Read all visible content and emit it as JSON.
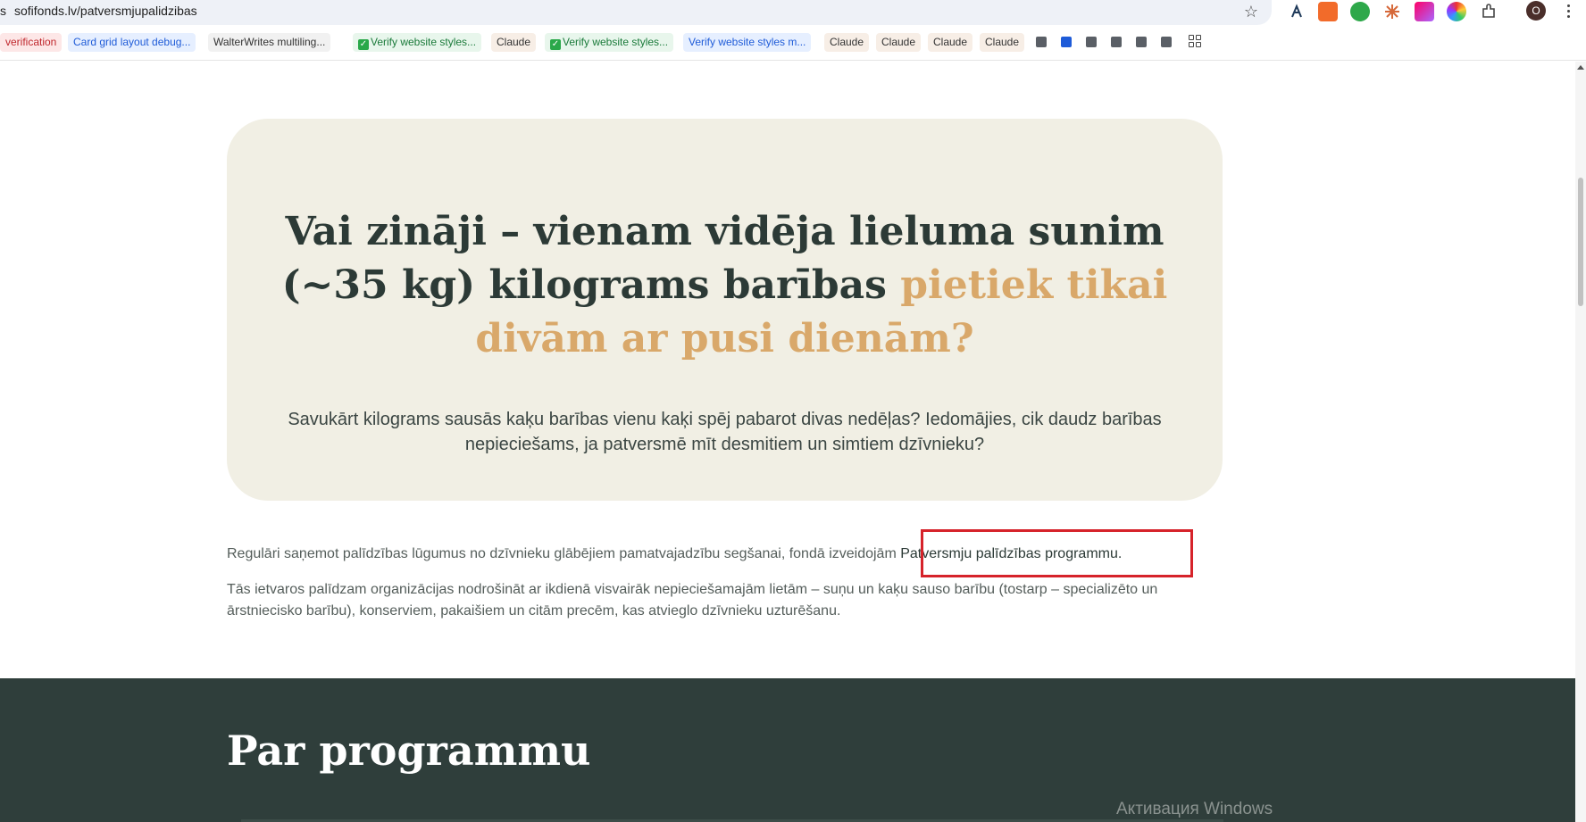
{
  "browser": {
    "url_edge": "s",
    "url": "sofifonds.lv/patversmjupalidzibas",
    "avatar_letter": "O",
    "accent_blue": "#1e5bd8"
  },
  "bookmarks": [
    {
      "label": "verification"
    },
    {
      "label": "Card grid layout debug..."
    },
    {
      "label": "WalterWrites multiling..."
    },
    {
      "label": "Verify website styles..."
    },
    {
      "label": "Claude"
    },
    {
      "label": "Verify website styles..."
    },
    {
      "label": "Verify website styles m..."
    },
    {
      "label": "Claude"
    },
    {
      "label": "Claude"
    },
    {
      "label": "Claude"
    },
    {
      "label": "Claude"
    }
  ],
  "hero": {
    "title_part1": "Vai zināji – vienam vidēja lieluma sunim (~35 kg) kilograms barības ",
    "title_accent": "pietiek tikai divām ar pusi dienām?",
    "subtitle": "Savukārt kilograms sausās kaķu barības vienu kaķi spēj pabarot divas nedēļas? Iedomājies, cik daudz barības nepieciešams, ja patversmē mīt desmitiem un simtiem dzīvnieku?",
    "card_color": "#f1efe4",
    "accent_color": "#d9a86a"
  },
  "content": {
    "para1_text": "Regulāri saņemot palīdzības lūgumus no dzīvnieku glābējiem pamatvajadzību segšanai, fondā izveidojām ",
    "para1_strong": "Patversmju palīdzības programmu.",
    "para2": "Tās ietvaros palīdzam organizācijas nodrošināt ar ikdienā visvairāk nepieciešamajām lietām – suņu un kaķu sauso barību (tostarp – specializēto un ārstniecisko barību), konserviem, pakaišiem un citām precēm, kas atvieglo dzīvnieku uzturēšanu."
  },
  "section": {
    "title": "Par programmu",
    "bg_color": "#2f3e3b"
  },
  "watermark": "Активация Windows"
}
